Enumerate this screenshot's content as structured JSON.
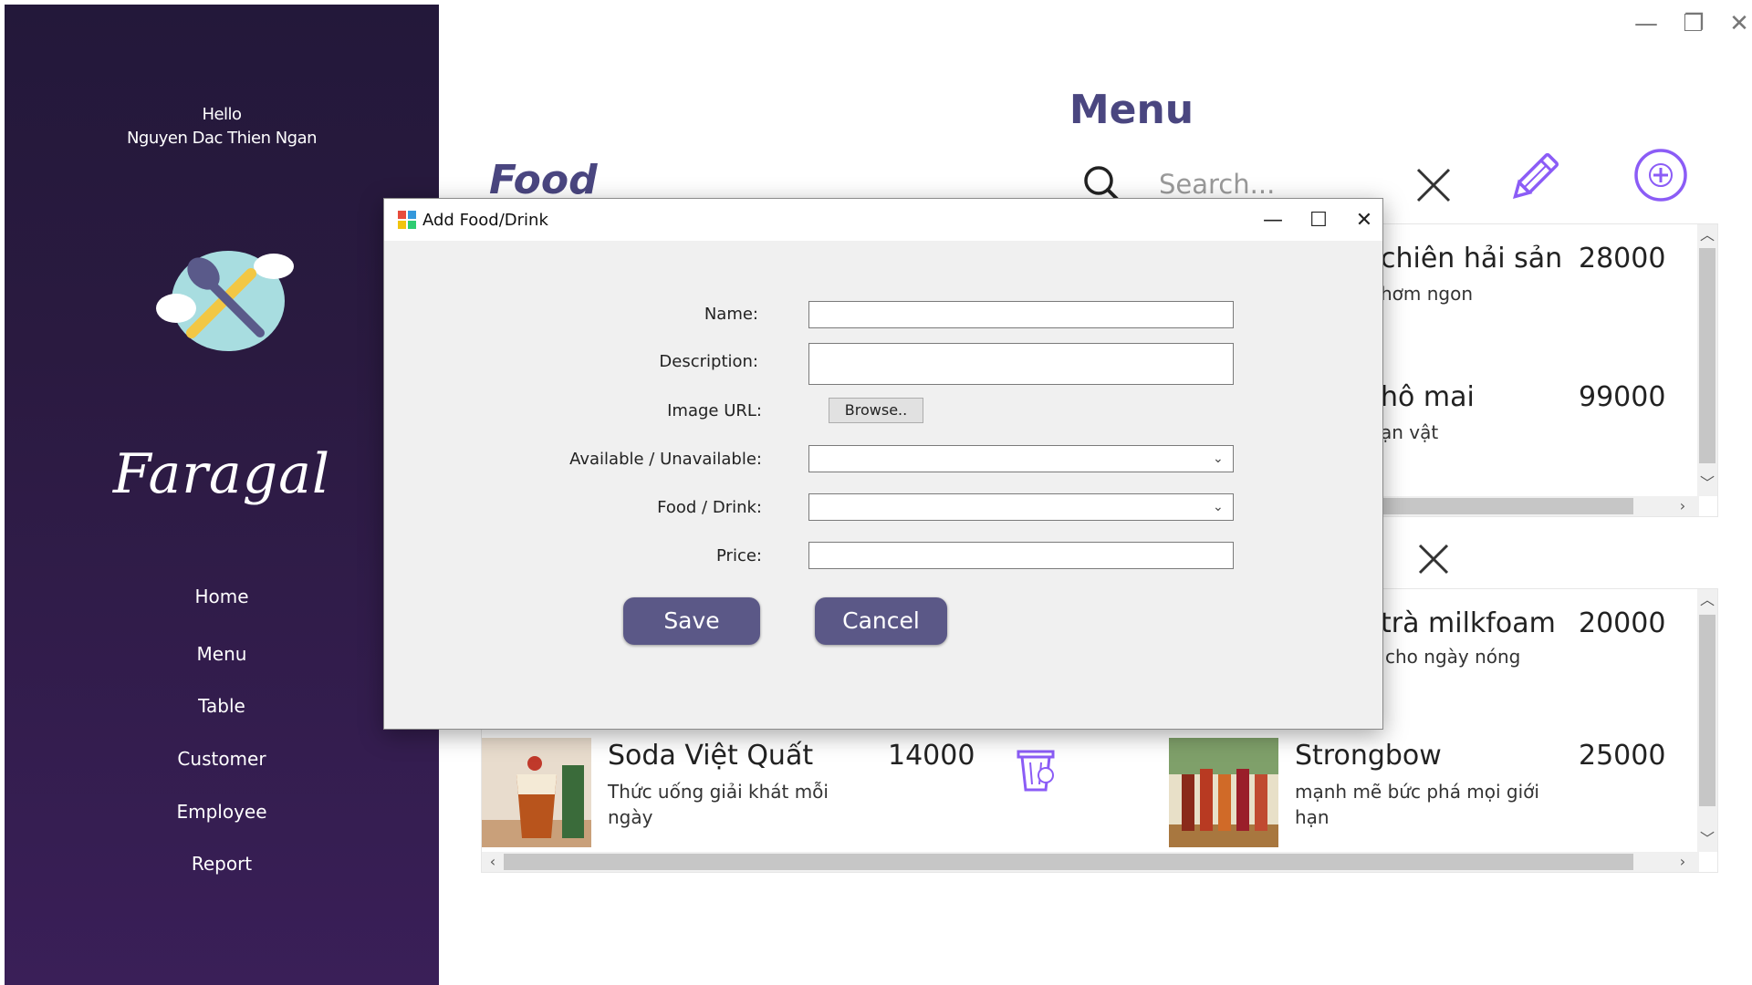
{
  "sidebar": {
    "greeting": "Hello",
    "username": "Nguyen Dac Thien Ngan",
    "brand": "Faragal",
    "nav": [
      "Home",
      "Menu",
      "Table",
      "Customer",
      "Employee",
      "Report"
    ]
  },
  "window_controls": {
    "minimize": "—",
    "maximize": "❐",
    "close": "✕"
  },
  "main": {
    "title": "Menu",
    "section": "Food",
    "search_placeholder": "Search..."
  },
  "food_items": [
    {
      "name": "chiên hải sản",
      "desc": "hơm ngon",
      "price": "28000"
    },
    {
      "name": "hô mai",
      "desc": "ạn vật",
      "price": "99000"
    }
  ],
  "drink_items": [
    {
      "name": "trà milkfoam",
      "desc": "cho ngày nóng",
      "price": "20000"
    },
    {
      "name": "Soda Việt Quất",
      "desc": "Thức uống giải khát mỗi ngày",
      "price": "14000"
    },
    {
      "name": "Strongbow",
      "desc": "mạnh mẽ bức phá mọi giới hạn",
      "price": "25000"
    }
  ],
  "dialog": {
    "title": "Add Food/Drink",
    "labels": {
      "name": "Name:",
      "description": "Description:",
      "image_url": "Image URL:",
      "availability": "Available / Unavailable:",
      "type": "Food / Drink:",
      "price": "Price:"
    },
    "browse": "Browse..",
    "save": "Save",
    "cancel": "Cancel",
    "values": {
      "name": "",
      "description": "",
      "availability": "",
      "type": "",
      "price": ""
    }
  },
  "colors": {
    "accent": "#4a4680",
    "button": "#5b5887",
    "icon_purple": "#8b5cf6"
  }
}
